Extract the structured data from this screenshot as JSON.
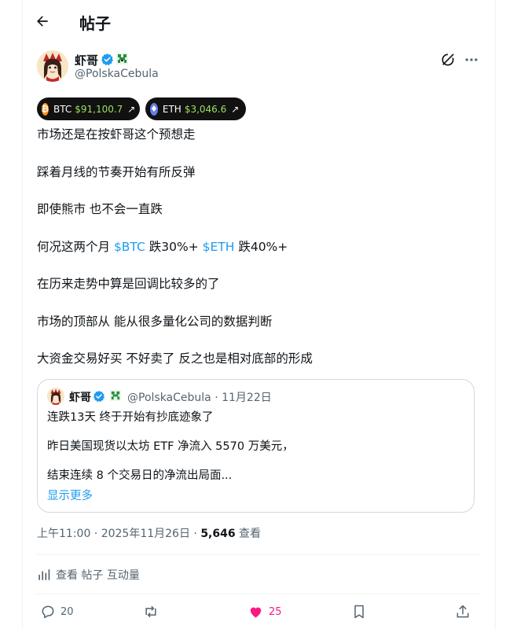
{
  "header": {
    "title": "帖子"
  },
  "author": {
    "name": "虾哥",
    "handle": "@PolskaCebula"
  },
  "tickers": [
    {
      "symbol": "BTC",
      "price": "$91,100.7",
      "color": "#f7931a"
    },
    {
      "symbol": "ETH",
      "price": "$3,046.6",
      "color": "#627eea"
    }
  ],
  "post": {
    "line1": "市场还是在按虾哥这个预想走",
    "line2": "踩着月线的节奏开始有所反弹",
    "line3": "即使熊市 也不会一直跌",
    "line4_prefix": "何况这两个月 ",
    "cashtag_btc": "$BTC",
    "line4_mid": " 跌30%+ ",
    "cashtag_eth": "$ETH",
    "line4_suffix": " 跌40%+",
    "line5": "在历来走势中算是回调比较多的了",
    "line6": "市场的顶部从 能从很多量化公司的数据判断",
    "line7": "大资金交易好买 不好卖了 反之也是相对底部的形成"
  },
  "quote": {
    "name": "虾哥",
    "meta": "@PolskaCebula · 11月22日",
    "line1": "连跌13天 终于开始有抄底迹象了",
    "line2": "昨日美国现货以太坊 ETF 净流入 5570 万美元，",
    "line3": "结束连续 8 个交易日的净流出局面...",
    "show_more": "显示更多"
  },
  "meta": {
    "time": "上午11:00 · 2025年11月26日 · ",
    "views": "5,646",
    "views_label": " 查看"
  },
  "analytics": {
    "label": "查看 帖子 互动量"
  },
  "actions": {
    "replies": "20",
    "likes": "25"
  },
  "colors": {
    "accent": "#1d9bf0",
    "like": "#f91880",
    "price_green": "#9be15d"
  }
}
